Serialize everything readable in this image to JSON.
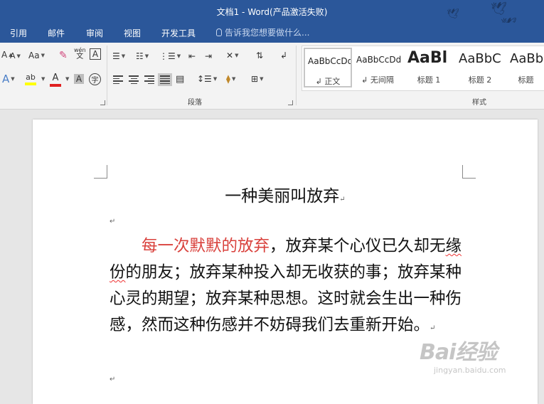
{
  "window": {
    "title": "文档1 - Word(产品激活失败)"
  },
  "tabs": [
    "引用",
    "邮件",
    "审阅",
    "视图",
    "开发工具"
  ],
  "tell_me": {
    "placeholder": "告诉我您想要做什么..."
  },
  "ribbon": {
    "font_group": {
      "aa_label": "Aa",
      "wen_label": "wén",
      "wen_char": "文",
      "a_box": "A",
      "char_shade": "A",
      "enclose": "字"
    },
    "paragraph_group": {
      "label": "段落"
    },
    "styles_group": {
      "label": "样式",
      "items": [
        {
          "sample": "AaBbCcDd",
          "name": "↲ 正文"
        },
        {
          "sample": "AaBbCcDd",
          "name": "↲ 无间隔"
        },
        {
          "sample": "AaBl",
          "name": "标题 1"
        },
        {
          "sample": "AaBbC",
          "name": "标题 2"
        },
        {
          "sample": "AaBb",
          "name": "标题"
        }
      ]
    }
  },
  "document": {
    "title": "一种美丽叫放弃",
    "paragraph_mark": "↵",
    "para_red": "每一次默默的放弃",
    "para_rest": "，放弃某个心仪已久却无",
    "para_wavy": "缘份",
    "para_tail": "的朋友；放弃某种投入却无收获的事；放弃某种心灵的期望；放弃某种思想。这时就会生出一种伤感，然而这种伤感并不妨碍我们去重新开始。"
  },
  "watermark": {
    "brand": "Bai经验",
    "url": "jingyan.baidu.com"
  }
}
